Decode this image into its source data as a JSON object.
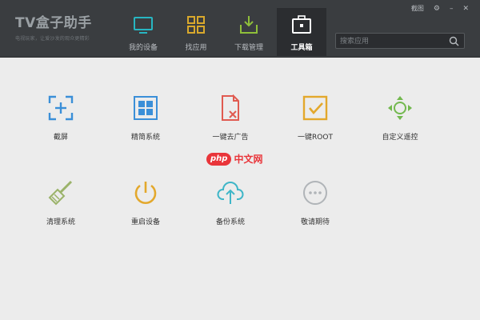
{
  "app": {
    "title": "TV盒子助手",
    "subtitle": "电视玩家，让爱沙发的观众更精彩"
  },
  "window_controls": {
    "feedback_label": "截图",
    "settings_glyph": "⚙",
    "minimize_glyph": "–",
    "close_glyph": "✕"
  },
  "nav": [
    {
      "label": "我的设备",
      "icon": "tv-icon",
      "color": "#27b6c2"
    },
    {
      "label": "找应用",
      "icon": "grid-icon",
      "color": "#d9a92c"
    },
    {
      "label": "下载管理",
      "icon": "download-icon",
      "color": "#8fbf3a"
    },
    {
      "label": "工具箱",
      "icon": "toolbox-icon",
      "color": "#ffffff",
      "active": true
    }
  ],
  "search": {
    "placeholder": "搜索应用"
  },
  "tools": [
    {
      "label": "截屏",
      "icon": "screenshot-icon",
      "color": "#3b8fd8"
    },
    {
      "label": "精简系统",
      "icon": "grid-icon",
      "color": "#3b8fd8"
    },
    {
      "label": "一键去广告",
      "icon": "ad-remove-icon",
      "color": "#e05a50"
    },
    {
      "label": "一键ROOT",
      "icon": "root-icon",
      "color": "#e3a82c"
    },
    {
      "label": "自定义遥控",
      "icon": "remote-icon",
      "color": "#72b84e"
    },
    {
      "label": "清理系统",
      "icon": "broom-icon",
      "color": "#9bb36a"
    },
    {
      "label": "重启设备",
      "icon": "power-icon",
      "color": "#e3a82c"
    },
    {
      "label": "备份系统",
      "icon": "cloud-upload-icon",
      "color": "#3fb6c8"
    },
    {
      "label": "敬请期待",
      "icon": "more-icon",
      "color": "#b0b4b8"
    }
  ],
  "watermark": {
    "badge": "php",
    "text": "中文网"
  }
}
